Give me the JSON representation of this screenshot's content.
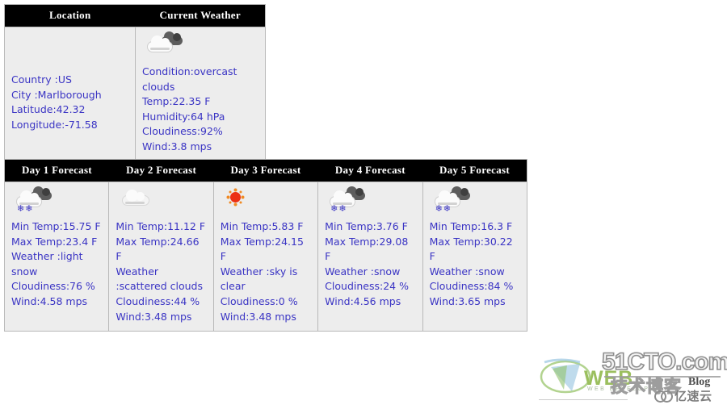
{
  "location_table": {
    "headers": [
      "Location",
      "Current Weather"
    ],
    "location": {
      "country": "Country :US",
      "city": "City :Marlborough",
      "latitude": "Latitude:42.32",
      "longitude": "Longitude:-71.58"
    },
    "current": {
      "icon": "overcast-clouds-icon",
      "condition": "Condition:overcast clouds",
      "temp": "Temp:22.35 F",
      "humidity": "Humidity:64 hPa",
      "cloudiness": "Cloudiness:92%",
      "wind": "Wind:3.8 mps"
    }
  },
  "forecast_table": {
    "headers": [
      "Day 1 Forecast",
      "Day 2 Forecast",
      "Day 3 Forecast",
      "Day 4 Forecast",
      "Day 5 Forecast"
    ],
    "days": [
      {
        "icon": "snow-icon",
        "min_temp": "Min Temp:15.75 F",
        "max_temp": "Max Temp:23.4 F",
        "weather": "Weather :light snow",
        "cloudiness": "Cloudiness:76 %",
        "wind": "Wind:4.58 mps"
      },
      {
        "icon": "scattered-clouds-icon",
        "min_temp": "Min Temp:11.12 F",
        "max_temp": "Max Temp:24.66 F",
        "weather": "Weather :scattered clouds",
        "cloudiness": "Cloudiness:44 %",
        "wind": "Wind:3.48 mps"
      },
      {
        "icon": "clear-sky-sun-icon",
        "min_temp": "Min Temp:5.83 F",
        "max_temp": "Max Temp:24.15 F",
        "weather": "Weather :sky is clear",
        "cloudiness": "Cloudiness:0 %",
        "wind": "Wind:3.48 mps"
      },
      {
        "icon": "snow-icon",
        "min_temp": "Min Temp:3.76 F",
        "max_temp": "Max Temp:29.08 F",
        "weather": "Weather :snow",
        "cloudiness": "Cloudiness:24 %",
        "wind": "Wind:4.56 mps"
      },
      {
        "icon": "snow-icon",
        "min_temp": "Min Temp:16.3 F",
        "max_temp": "Max Temp:30.22 F",
        "weather": "Weather :snow",
        "cloudiness": "Cloudiness:84 %",
        "wind": "Wind:3.65 mps"
      }
    ]
  },
  "watermarks": {
    "web_text": "WEB",
    "web_sub": "WEB DEVELOPER",
    "cto": "51CTO.com",
    "cto_cn": "技术博客",
    "blog": "Blog",
    "yisuyun": "亿速云"
  },
  "colors": {
    "header_bg": "#000000",
    "header_text": "#ffffff",
    "body_text": "#3a34c4",
    "cell_bg": "#ededed",
    "border": "#b9b9b9"
  }
}
